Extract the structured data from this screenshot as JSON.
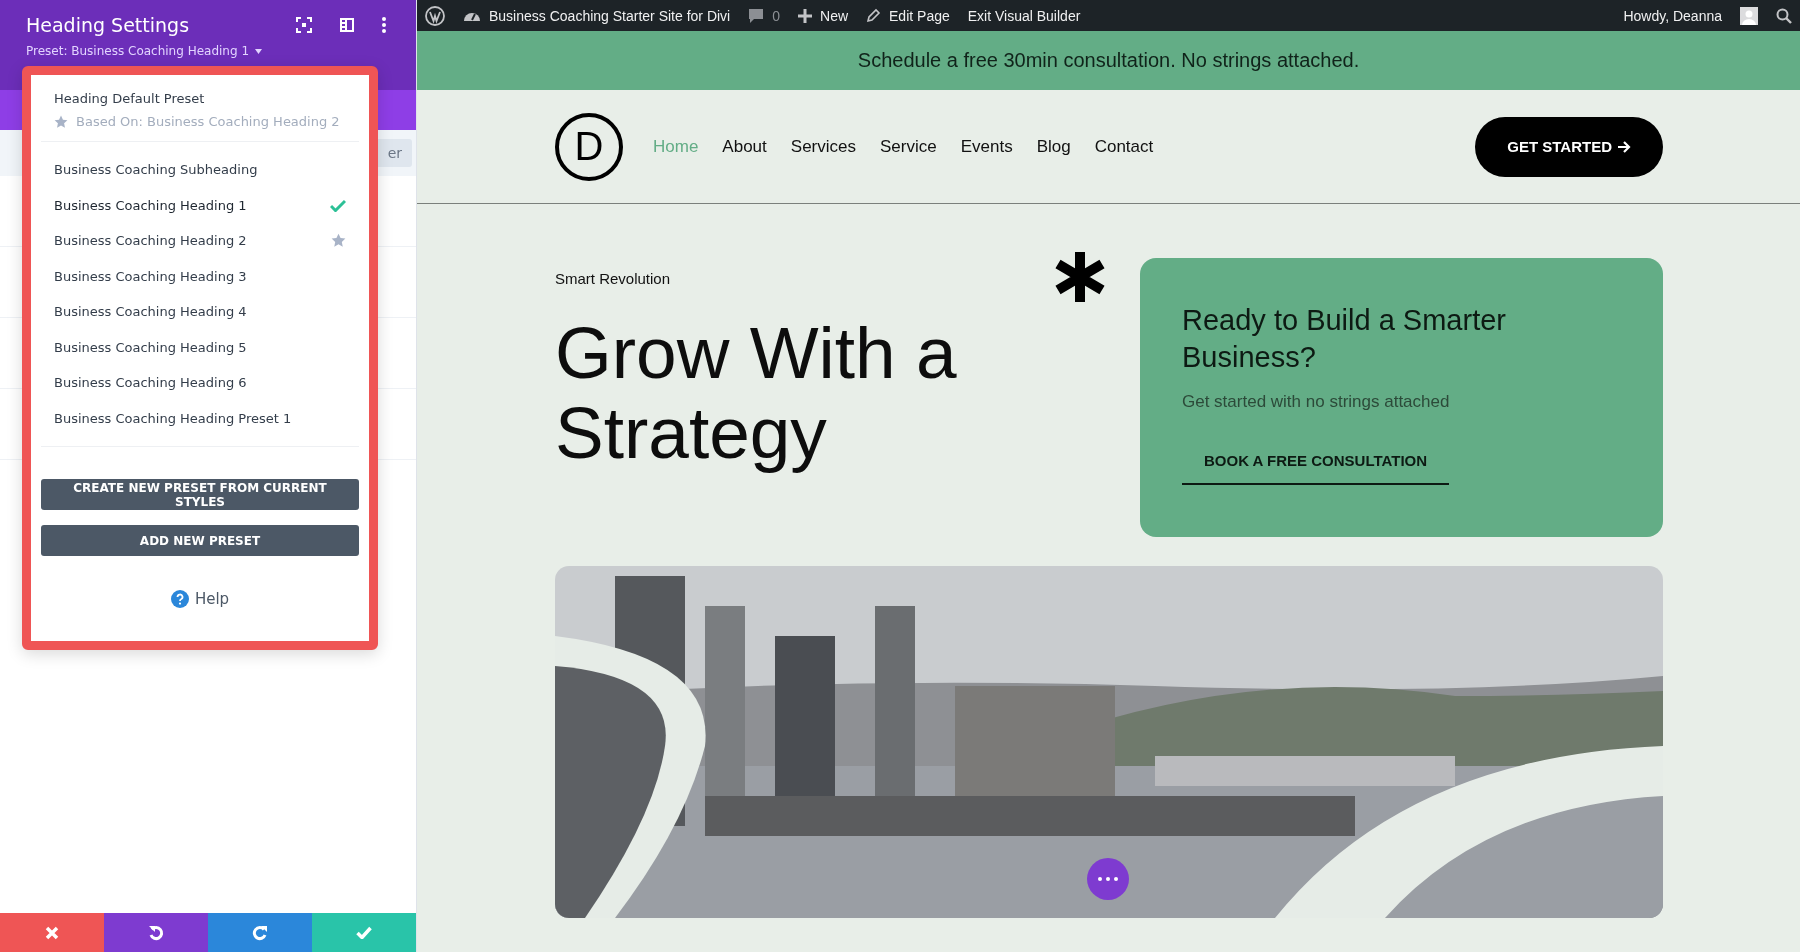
{
  "panel": {
    "title": "Heading Settings",
    "preset": "Preset: Business Coaching Heading 1",
    "behind_button": "er",
    "popup": {
      "default_preset": {
        "label": "Heading Default Preset",
        "based_on": "Based On: Business Coaching Heading 2"
      },
      "items": [
        {
          "label": "Business Coaching Subheading",
          "selected": false,
          "starred": false
        },
        {
          "label": "Business Coaching Heading 1",
          "selected": true,
          "starred": false
        },
        {
          "label": "Business Coaching Heading 2",
          "selected": false,
          "starred": true
        },
        {
          "label": "Business Coaching Heading 3",
          "selected": false,
          "starred": false
        },
        {
          "label": "Business Coaching Heading 4",
          "selected": false,
          "starred": false
        },
        {
          "label": "Business Coaching Heading 5",
          "selected": false,
          "starred": false
        },
        {
          "label": "Business Coaching Heading 6",
          "selected": false,
          "starred": false
        },
        {
          "label": "Business Coaching Heading Preset 1",
          "selected": false,
          "starred": false
        }
      ],
      "buttons": [
        "CREATE NEW PRESET FROM CURRENT STYLES",
        "ADD NEW PRESET"
      ],
      "help": "Help"
    },
    "footer": [
      {
        "kind": "close"
      },
      {
        "kind": "undo"
      },
      {
        "kind": "redo"
      },
      {
        "kind": "save"
      }
    ]
  },
  "admin_bar": {
    "site": "Business Coaching Starter Site for Divi",
    "comments": "0",
    "new": "New",
    "edit": "Edit Page",
    "exit": "Exit Visual Builder",
    "greeting": "Howdy, Deanna"
  },
  "banner": "Schedule a free 30min consultation. No strings attached.",
  "nav": {
    "logo": "D",
    "items": [
      {
        "label": "Home",
        "selected": true
      },
      {
        "label": "About",
        "selected": false
      },
      {
        "label": "Services",
        "selected": false
      },
      {
        "label": "Service",
        "selected": false
      },
      {
        "label": "Events",
        "selected": false
      },
      {
        "label": "Blog",
        "selected": false
      },
      {
        "label": "Contact",
        "selected": false
      }
    ],
    "cta": "GET STARTED"
  },
  "hero": {
    "eyebrow": "Smart Revolution",
    "heading": "Grow With a Strategy",
    "card": {
      "title": "Ready to Build a Smarter Business?",
      "subtitle": "Get started with no strings attached",
      "button": "BOOK A FREE CONSULTATION"
    }
  }
}
